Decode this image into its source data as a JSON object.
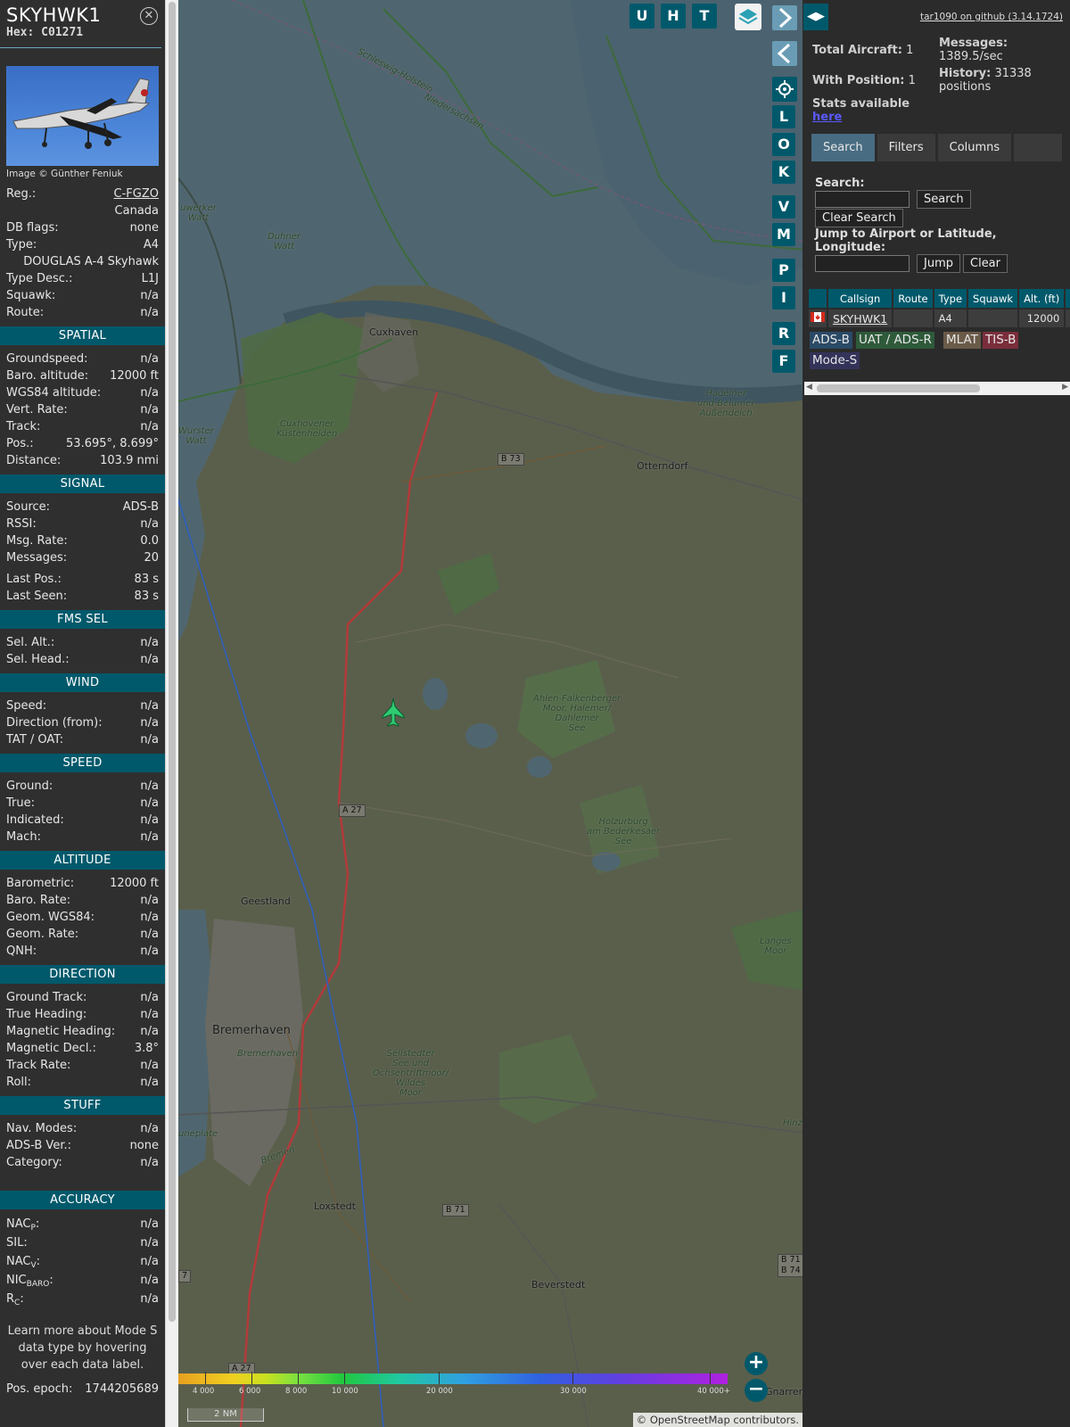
{
  "aircraft": {
    "callsign": "SKYHWK1",
    "hex": "Hex: C01271",
    "photo_credit": "Image © Günther Feniuk",
    "basic": [
      {
        "label": "Reg.:",
        "value": "C-FGZO",
        "link": true
      },
      {
        "label": "",
        "value": "Canada"
      },
      {
        "label": "DB flags:",
        "value": "none"
      },
      {
        "label": "Type:",
        "value": "A4"
      },
      {
        "label": "",
        "value": "DOUGLAS A-4 Skyhawk"
      },
      {
        "label": "Type Desc.:",
        "value": "L1J"
      },
      {
        "label": "Squawk:",
        "value": "n/a"
      },
      {
        "label": "Route:",
        "value": "n/a"
      }
    ],
    "sections": [
      {
        "title": "SPATIAL",
        "rows": [
          {
            "label": "Groundspeed:",
            "value": "n/a"
          },
          {
            "label": "Baro. altitude:",
            "value": "12000 ft"
          },
          {
            "label": "WGS84 altitude:",
            "value": "n/a"
          },
          {
            "label": "Vert. Rate:",
            "value": "n/a"
          },
          {
            "label": "Track:",
            "value": "n/a"
          },
          {
            "label": "Pos.:",
            "value": "53.695°, 8.699°"
          },
          {
            "label": "Distance:",
            "value": "103.9 nmi"
          }
        ]
      },
      {
        "title": "SIGNAL",
        "rows": [
          {
            "label": "Source:",
            "value": "ADS-B"
          },
          {
            "label": "RSSI:",
            "value": "n/a"
          },
          {
            "label": "Msg. Rate:",
            "value": "0.0"
          },
          {
            "label": "Messages:",
            "value": "20"
          },
          {
            "label": "Last Pos.:",
            "value": "83 s"
          },
          {
            "label": "Last Seen:",
            "value": "83 s"
          }
        ]
      },
      {
        "title": "FMS SEL",
        "rows": [
          {
            "label": "Sel. Alt.:",
            "value": "n/a"
          },
          {
            "label": "Sel. Head.:",
            "value": "n/a"
          }
        ]
      },
      {
        "title": "WIND",
        "rows": [
          {
            "label": "Speed:",
            "value": "n/a"
          },
          {
            "label": "Direction (from):",
            "value": "n/a"
          },
          {
            "label": "TAT / OAT:",
            "value": "n/a"
          }
        ]
      },
      {
        "title": "SPEED",
        "rows": [
          {
            "label": "Ground:",
            "value": "n/a"
          },
          {
            "label": "True:",
            "value": "n/a"
          },
          {
            "label": "Indicated:",
            "value": "n/a"
          },
          {
            "label": "Mach:",
            "value": "n/a"
          }
        ]
      },
      {
        "title": "ALTITUDE",
        "rows": [
          {
            "label": "Barometric:",
            "value": "12000 ft"
          },
          {
            "label": "Baro. Rate:",
            "value": "n/a"
          },
          {
            "label": "Geom. WGS84:",
            "value": "n/a"
          },
          {
            "label": "Geom. Rate:",
            "value": "n/a"
          },
          {
            "label": "QNH:",
            "value": "n/a"
          }
        ]
      },
      {
        "title": "DIRECTION",
        "rows": [
          {
            "label": "Ground Track:",
            "value": "n/a"
          },
          {
            "label": "True Heading:",
            "value": "n/a"
          },
          {
            "label": "Magnetic Heading:",
            "value": "n/a"
          },
          {
            "label": "Magnetic Decl.:",
            "value": "3.8°"
          },
          {
            "label": "Track Rate:",
            "value": "n/a"
          },
          {
            "label": "Roll:",
            "value": "n/a"
          }
        ]
      },
      {
        "title": "STUFF",
        "rows": [
          {
            "label": "Nav. Modes:",
            "value": "n/a"
          },
          {
            "label": "ADS-B Ver.:",
            "value": "none"
          },
          {
            "label": "Category:",
            "value": "n/a"
          }
        ]
      }
    ],
    "accuracy": {
      "title": "ACCURACY",
      "rows": [
        {
          "main": "NAC",
          "sub": "P",
          "value": "n/a"
        },
        {
          "main": "SIL",
          "sub": "",
          "value": "n/a"
        },
        {
          "main": "NAC",
          "sub": "V",
          "value": "n/a"
        },
        {
          "main": "NIC",
          "sub": "BARO",
          "value": "n/a"
        },
        {
          "main": "R",
          "sub": "C",
          "value": "n/a"
        }
      ]
    },
    "note": "Learn more about Mode S data type by hovering over each data label.",
    "epoch_label": "Pos. epoch:",
    "epoch_value": "1744205689"
  },
  "map": {
    "buttons": [
      "U",
      "H",
      "T"
    ],
    "side_buttons": [
      "L",
      "O",
      "K",
      "V",
      "M",
      "P",
      "I",
      "R",
      "F"
    ],
    "labels": {
      "cuxhaven": "Cuxhaven",
      "otterndorf": "Otterndorf",
      "geestland": "Geestland",
      "bremerhaven": "Bremerhaven",
      "bremerhaven_sm": "Bremerhaven",
      "loxstedt": "Loxstedt",
      "beverstedt": "Beverstedt",
      "bremen": "Bremen",
      "schleswig": "Schleswig-Holstein",
      "niedersachsen": "Niedersachsen",
      "duhner": "Duhner\nWatt",
      "neuwerker": "uwerker\nWatt",
      "cuxkust": "Cuxhovener\nKüstenheiden",
      "wurster": "Wurster\nWatt",
      "hadelner": "Hadelner\nund Belumer\nAußendeich",
      "ahlen": "Ahlen-Falkenberger\nMoor, Halemer/\nDahlemer\nSee",
      "holzurburg": "Holzurburg\nam Bederkesaer\nSee",
      "langes": "Langes\nMoor",
      "sellstedter": "Sellstedter\nSee und\nOchsentriftmoor/\nWildes\nMoor",
      "hinz": "Hinz",
      "gnarren": "Gnarren",
      "uneplate": "uneplate"
    },
    "shields": {
      "b73": "B 73",
      "a27": "A 27",
      "a27b": "A 27",
      "b71": "B 71",
      "b71b": "B 71\nB 74",
      "b7": "7"
    },
    "colorbar_ticks": [
      "4 000",
      "6 000",
      "8 000",
      "10 000",
      "20 000",
      "30 000",
      "40 000+"
    ],
    "scale": "2 NM",
    "attribution_prefix": "© ",
    "attribution_link": "OpenStreetMap",
    "attribution_suffix": " contributors."
  },
  "side": {
    "version": "tar1090 on github (3.14.1724)",
    "total_label": "Total Aircraft:",
    "total_value": "1",
    "pos_label": "With Position:",
    "pos_value": "1",
    "stats_label": "Stats available",
    "stats_link": "here",
    "messages_label": "Messages:",
    "messages_value": "1389.5/sec",
    "history_label": "History:",
    "history_value": "31338",
    "history_unit": "positions",
    "tabs": [
      "Search",
      "Filters",
      "Columns"
    ],
    "search_label": "Search:",
    "search_button": "Search",
    "clear_search_button": "Clear Search",
    "jump_label": "Jump to Airport or Latitude, Longitude:",
    "jump_button": "Jump",
    "clear_button": "Clear",
    "columns": [
      "",
      "Callsign",
      "Route",
      "Type",
      "Squawk",
      "Alt. (ft)",
      "Sp"
    ],
    "rows": [
      {
        "flag": "ca",
        "callsign": "SKYHWK1",
        "route": "",
        "type": "A4",
        "squawk": "",
        "alt": "12000",
        "speed": ""
      }
    ],
    "source_chips": [
      {
        "label": "ADS-B",
        "color": "#2a4a66"
      },
      {
        "label": "UAT / ADS-R",
        "color": "#2e5a3a"
      },
      {
        "label": "MLAT",
        "color": "#6a5a48"
      },
      {
        "label": "TIS-B",
        "color": "#7a2e3c"
      },
      {
        "label": "Mode-S",
        "color": "#33335a"
      }
    ]
  },
  "colors": {
    "accent": "#00596b",
    "plane": "#2ecc71",
    "route": "#c0392b"
  }
}
